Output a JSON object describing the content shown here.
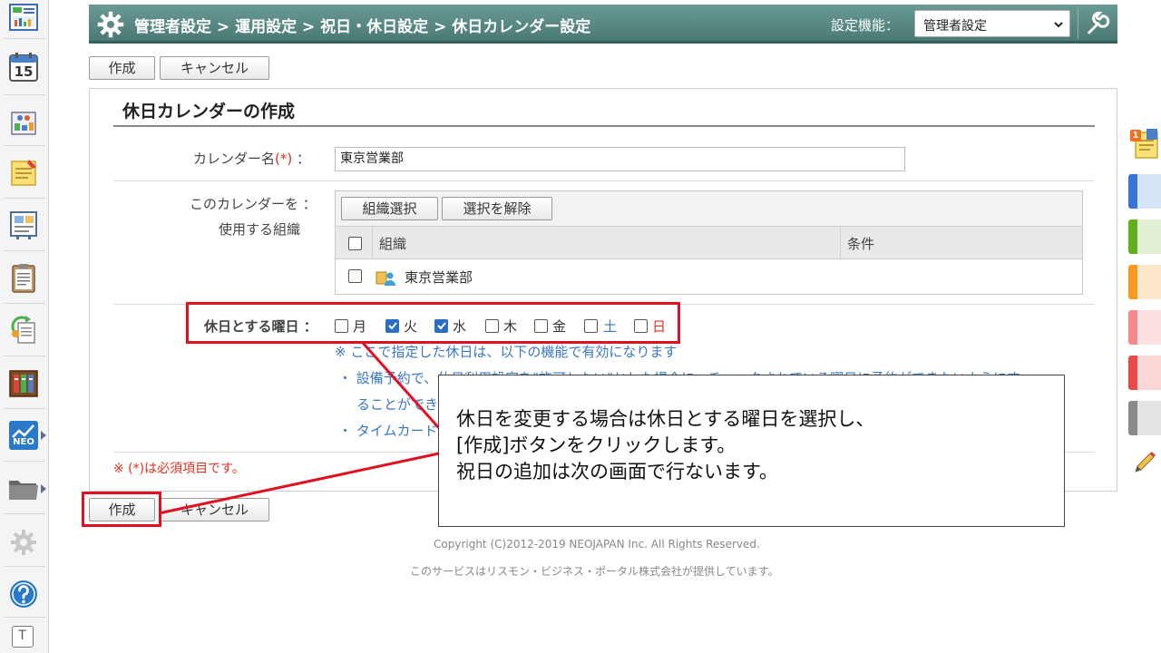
{
  "header": {
    "breadcrumb": "管理者設定 > 運用設定 > 祝日・休日設定 > 休日カレンダー設定",
    "function_label": "設定機能：",
    "function_selected": "管理者設定"
  },
  "toolbar": {
    "create_label": "作成",
    "cancel_label": "キャンセル"
  },
  "form": {
    "title": "休日カレンダーの作成",
    "name_label": "カレンダー名",
    "required_mark": "(*)",
    "colon": "：",
    "name_value": "東京営業部",
    "org_label_1": "このカレンダーを ：",
    "org_label_2": "使用する組織",
    "org_select_label": "組織選択",
    "org_clear_label": "選択を解除",
    "org_columns": [
      "組織",
      "条件"
    ],
    "org_rows": [
      {
        "name": "東京営業部",
        "condition": ""
      }
    ],
    "weekday_label": "休日とする曜日 ：",
    "weekdays": [
      {
        "label": "月",
        "checked": false,
        "color": "#333333"
      },
      {
        "label": "火",
        "checked": true,
        "color": "#333333"
      },
      {
        "label": "水",
        "checked": true,
        "color": "#333333"
      },
      {
        "label": "木",
        "checked": false,
        "color": "#333333"
      },
      {
        "label": "金",
        "checked": false,
        "color": "#333333"
      },
      {
        "label": "土",
        "checked": false,
        "color": "#3b78c4"
      },
      {
        "label": "日",
        "checked": false,
        "color": "#e03020"
      }
    ],
    "note_1": "※ ここで指定した休日は、以下の機能で有効になります",
    "note_2": "・ 設備予約で、休日利用設定を\"許可しない\"とした場合に、チェックされている曜日に予約ができないようにす",
    "note_3": "ることができ",
    "note_4": "・ タイムカード",
    "required_note": "※ (*)は必須項目です。"
  },
  "footer": {
    "copyright": "Copyright (C)2012-2019 NEOJAPAN Inc. All Rights Reserved.",
    "provider": "このサービスはリスモン・ビジネス・ポータル株式会社が提供しています。"
  },
  "callout": {
    "line_1": "休日を変更する場合は休日とする曜日を選択し、",
    "line_2": "[作成]ボタンをクリックします。",
    "line_3": "祝日の追加は次の画面で行ないます。"
  },
  "colors": {
    "header": "#5a8a84",
    "accent_red": "#e01020",
    "note_blue": "#3b78c4"
  },
  "icons": {
    "left_sidebar": [
      "portal-icon",
      "schedule-icon",
      "facility-icon",
      "memo-icon",
      "board-icon",
      "report-icon",
      "workflow-icon",
      "cabinet-icon",
      "neo-icon",
      "folder-icon",
      "settings-icon",
      "help-icon",
      "text-icon"
    ],
    "right_strip": [
      "memo-pad-icon",
      "blue-tab",
      "green-tab",
      "orange-tab",
      "pink-tab",
      "red-tab",
      "gray-tab",
      "pencil-icon"
    ]
  },
  "schedule_icon_day": "15",
  "badge_count": "1",
  "neo_icon_text": "NEO",
  "text_icon_label": "T"
}
